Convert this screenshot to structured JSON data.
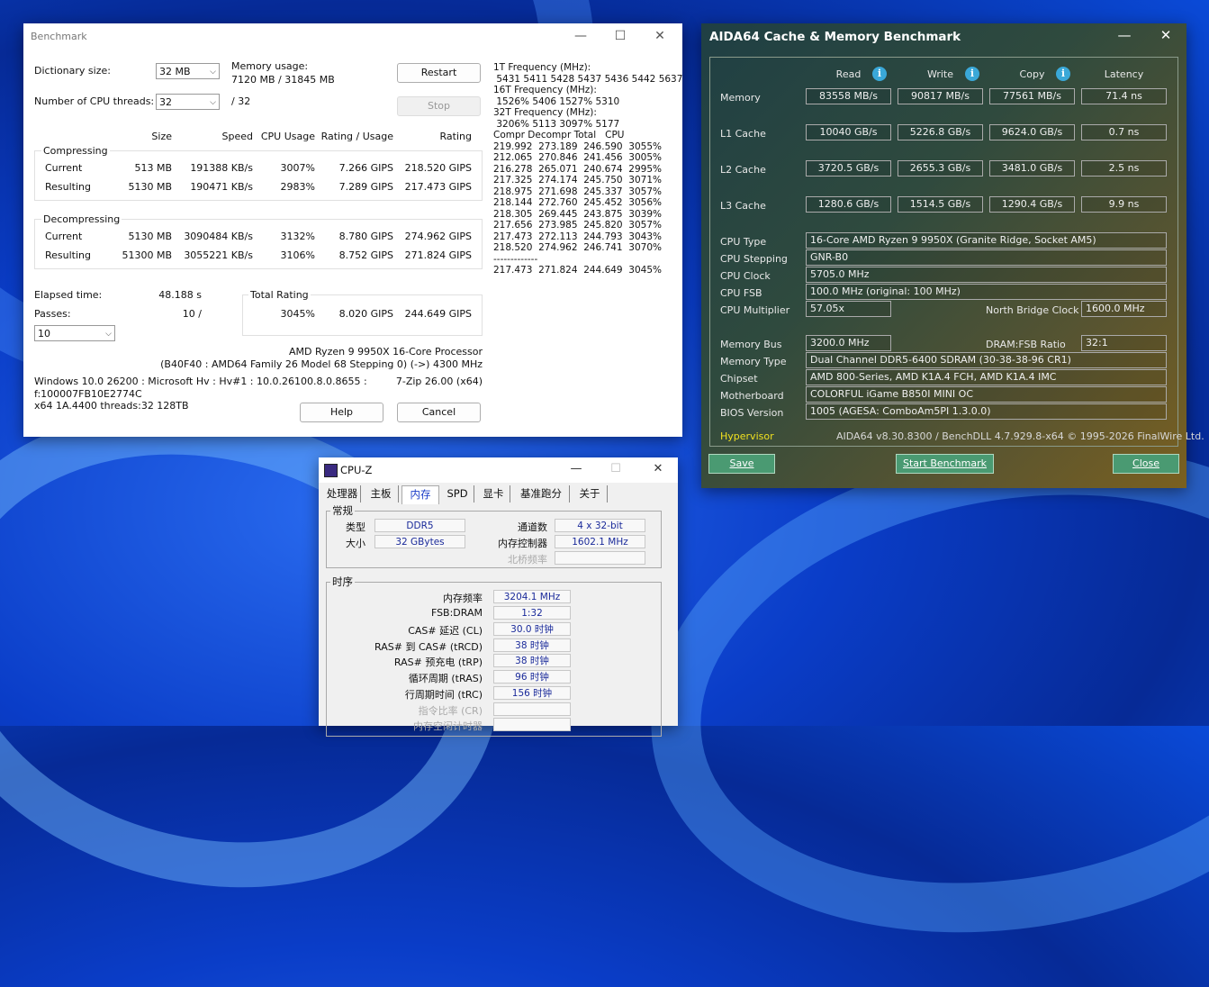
{
  "benchmark": {
    "title": "Benchmark",
    "dict_label": "Dictionary size:",
    "dict_value": "32 MB",
    "threads_label": "Number of CPU threads:",
    "threads_value": "32",
    "threads_max": "/ 32",
    "mem_usage_label": "Memory usage:",
    "mem_usage_value": "7120 MB / 31845 MB",
    "restart": "Restart",
    "stop": "Stop",
    "cols": {
      "size": "Size",
      "speed": "Speed",
      "cpu": "CPU Usage",
      "ru": "Rating / Usage",
      "rating": "Rating"
    },
    "compressing": "Compressing",
    "decompressing": "Decompressing",
    "comp_current": {
      "label": "Current",
      "size": "513 MB",
      "speed": "191388 KB/s",
      "cpu": "3007%",
      "ru": "7.266 GIPS",
      "rating": "218.520 GIPS"
    },
    "comp_result": {
      "label": "Resulting",
      "size": "5130 MB",
      "speed": "190471 KB/s",
      "cpu": "2983%",
      "ru": "7.289 GIPS",
      "rating": "217.473 GIPS"
    },
    "dec_current": {
      "label": "Current",
      "size": "5130 MB",
      "speed": "3090484 KB/s",
      "cpu": "3132%",
      "ru": "8.780 GIPS",
      "rating": "274.962 GIPS"
    },
    "dec_result": {
      "label": "Resulting",
      "size": "51300 MB",
      "speed": "3055221 KB/s",
      "cpu": "3106%",
      "ru": "8.752 GIPS",
      "rating": "271.824 GIPS"
    },
    "elapsed_label": "Elapsed time:",
    "elapsed_value": "48.188 s",
    "passes_label": "Passes:",
    "passes_value": "10 /",
    "passes_combo": "10",
    "total_label": "Total Rating",
    "total_cpu": "3045%",
    "total_ru": "8.020 GIPS",
    "total_rating": "244.649 GIPS",
    "cpu_name": "AMD Ryzen 9 9950X 16-Core Processor",
    "cpu_detail": "(B40F40 : AMD64 Family 26 Model 68 Stepping 0) (->) 4300 MHz",
    "os_line1": "Windows 10.0 26200 : Microsoft Hv : Hv#1 : 10.0.26100.8.0.8655 :",
    "os_line2": "f:100007FB10E2774C",
    "os_line3": "x64 1A.4400 threads:32 128TB",
    "version": "7-Zip 26.00 (x64)",
    "help": "Help",
    "cancel": "Cancel",
    "log": "1T Frequency (MHz):\n 5431 5411 5428 5437 5436 5442 5637\n16T Frequency (MHz):\n 1526% 5406 1527% 5310\n32T Frequency (MHz):\n 3206% 5113 3097% 5177\nCompr Decompr Total   CPU\n219.992  273.189  246.590  3055%\n212.065  270.846  241.456  3005%\n216.278  265.071  240.674  2995%\n217.325  274.174  245.750  3071%\n218.975  271.698  245.337  3057%\n218.144  272.760  245.452  3056%\n218.305  269.445  243.875  3039%\n217.656  273.985  245.820  3057%\n217.473  272.113  244.793  3043%\n218.520  274.962  246.741  3070%\n-------------\n217.473  271.824  244.649  3045%"
  },
  "aida": {
    "title": "AIDA64 Cache & Memory Benchmark",
    "headers": {
      "read": "Read",
      "write": "Write",
      "copy": "Copy",
      "latency": "Latency"
    },
    "rows": [
      {
        "label": "Memory",
        "read": "83558 MB/s",
        "write": "90817 MB/s",
        "copy": "77561 MB/s",
        "latency": "71.4 ns"
      },
      {
        "label": "L1 Cache",
        "read": "10040 GB/s",
        "write": "5226.8 GB/s",
        "copy": "9624.0 GB/s",
        "latency": "0.7 ns"
      },
      {
        "label": "L2 Cache",
        "read": "3720.5 GB/s",
        "write": "2655.3 GB/s",
        "copy": "3481.0 GB/s",
        "latency": "2.5 ns"
      },
      {
        "label": "L3 Cache",
        "read": "1280.6 GB/s",
        "write": "1514.5 GB/s",
        "copy": "1290.4 GB/s",
        "latency": "9.9 ns"
      }
    ],
    "cpu_type_label": "CPU Type",
    "cpu_type": "16-Core AMD Ryzen 9 9950X  (Granite Ridge, Socket AM5)",
    "cpu_stepping_label": "CPU Stepping",
    "cpu_stepping": "GNR-B0",
    "cpu_clock_label": "CPU Clock",
    "cpu_clock": "5705.0 MHz",
    "cpu_fsb_label": "CPU FSB",
    "cpu_fsb": "100.0 MHz  (original: 100 MHz)",
    "cpu_mult_label": "CPU Multiplier",
    "cpu_mult": "57.05x",
    "nb_clock_label": "North Bridge Clock",
    "nb_clock": "1600.0 MHz",
    "mem_bus_label": "Memory Bus",
    "mem_bus": "3200.0 MHz",
    "dram_ratio_label": "DRAM:FSB Ratio",
    "dram_ratio": "32:1",
    "mem_type_label": "Memory Type",
    "mem_type": "Dual Channel DDR5-6400 SDRAM  (30-38-38-96 CR1)",
    "chipset_label": "Chipset",
    "chipset": "AMD 800-Series, AMD K1A.4 FCH, AMD K1A.4 IMC",
    "mobo_label": "Motherboard",
    "mobo": "COLORFUL iGame B850I MINI OC",
    "bios_label": "BIOS Version",
    "bios": "1005  (AGESA: ComboAm5PI 1.3.0.0)",
    "hypervisor": "Hypervisor",
    "footer": "AIDA64 v8.30.8300 / BenchDLL 4.7.929.8-x64 © 1995-2026 FinalWire Ltd.",
    "save": "Save",
    "start": "Start Benchmark",
    "close": "Close",
    "hypervisor_color": "#f0e020"
  },
  "cpuz": {
    "title": "CPU-Z",
    "tabs": [
      "处理器",
      "主板",
      "内存",
      "SPD",
      "显卡",
      "基准跑分",
      "关于"
    ],
    "general_legend": "常规",
    "type_label": "类型",
    "type": "DDR5",
    "size_label": "大小",
    "size": "32 GBytes",
    "channels_label": "通道数",
    "channels": "4 x 32-bit",
    "mc_label": "内存控制器",
    "mc": "1602.1 MHz",
    "nb_label": "北桥频率",
    "timing_legend": "时序",
    "timings": [
      {
        "label": "内存频率",
        "value": "3204.1 MHz"
      },
      {
        "label": "FSB:DRAM",
        "value": "1:32"
      },
      {
        "label": "CAS# 延迟 (CL)",
        "value": "30.0 时钟"
      },
      {
        "label": "RAS# 到 CAS# (tRCD)",
        "value": "38 时钟"
      },
      {
        "label": "RAS# 预充电 (tRP)",
        "value": "38 时钟"
      },
      {
        "label": "循环周期 (tRAS)",
        "value": "96 时钟"
      },
      {
        "label": "行周期时间 (tRC)",
        "value": "156 时钟"
      },
      {
        "label": "指令比率 (CR)",
        "value": ""
      },
      {
        "label": "内存空闲计时器",
        "value": ""
      }
    ]
  }
}
